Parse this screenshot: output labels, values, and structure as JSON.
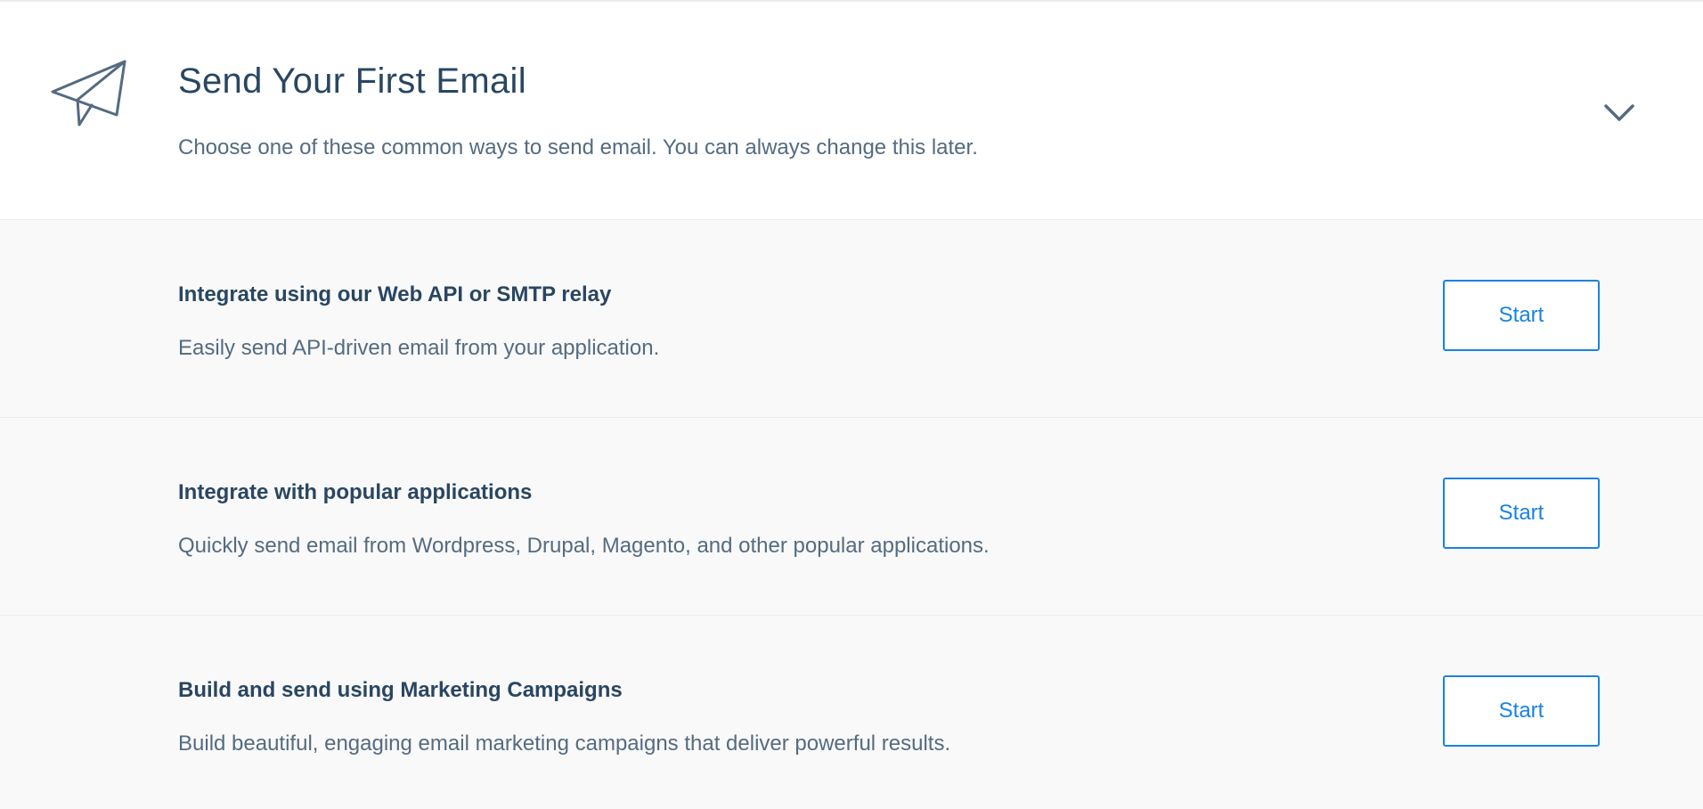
{
  "header": {
    "icon": "paper-plane-icon",
    "title": "Send Your First Email",
    "subtitle": "Choose one of these common ways to send email. You can always change this later.",
    "toggle_icon": "chevron-down-icon"
  },
  "options": [
    {
      "title": "Integrate using our Web API or SMTP relay",
      "description": "Easily send API-driven email from your application.",
      "button_label": "Start"
    },
    {
      "title": "Integrate with popular applications",
      "description": "Quickly send email from Wordpress, Drupal, Magento, and other popular applications.",
      "button_label": "Start"
    },
    {
      "title": "Build and send using Marketing Campaigns",
      "description": "Build beautiful, engaging email marketing campaigns that deliver powerful results.",
      "button_label": "Start"
    }
  ],
  "colors": {
    "text_dark": "#294661",
    "text_muted": "#546b81",
    "accent": "#1a82e2",
    "row_background": "#f9f9f9",
    "divider": "#e9ecef"
  }
}
